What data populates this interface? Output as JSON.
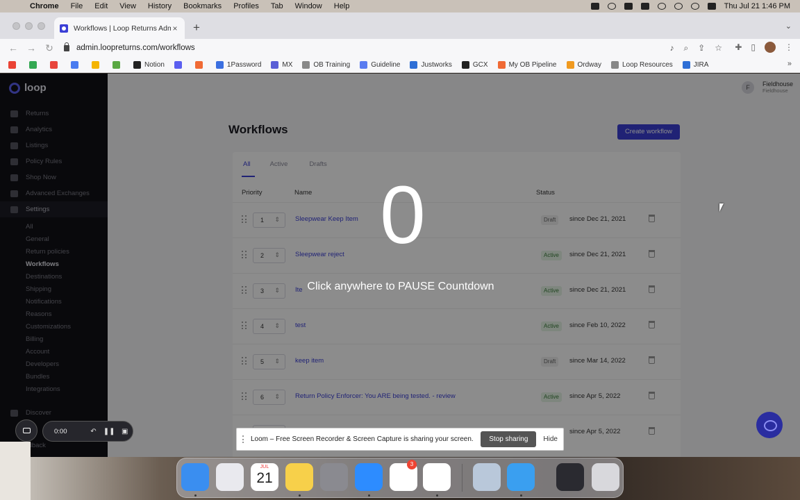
{
  "menubar": {
    "app": "Chrome",
    "items": [
      "File",
      "Edit",
      "View",
      "History",
      "Bookmarks",
      "Profiles",
      "Tab",
      "Window",
      "Help"
    ],
    "clock": "Thu Jul 21  1:46 PM"
  },
  "browser": {
    "tab_title": "Workflows | Loop Returns Adm",
    "url": "admin.loopreturns.com/workflows",
    "bookmarks": [
      {
        "label": "",
        "color": "#ea4335"
      },
      {
        "label": "",
        "color": "#34a853"
      },
      {
        "label": "",
        "color": "#e8453c"
      },
      {
        "label": "",
        "color": "#4a7cf0"
      },
      {
        "label": "",
        "color": "#f4b400"
      },
      {
        "label": "",
        "color": "#5aa843"
      },
      {
        "label": "Notion",
        "color": "#222222"
      },
      {
        "label": "",
        "color": "#5b5ff0"
      },
      {
        "label": "",
        "color": "#f06a35"
      },
      {
        "label": "1Password",
        "color": "#3b6fe0"
      },
      {
        "label": "MX",
        "color": "#5a5fd6"
      },
      {
        "label": "OB Training",
        "color": "#888888"
      },
      {
        "label": "Guideline",
        "color": "#5a7cf0"
      },
      {
        "label": "Justworks",
        "color": "#2f6fd6"
      },
      {
        "label": "GCX",
        "color": "#222222"
      },
      {
        "label": "My OB Pipeline",
        "color": "#f06a35"
      },
      {
        "label": "Ordway",
        "color": "#f09a20"
      },
      {
        "label": "Loop Resources",
        "color": "#888888"
      },
      {
        "label": "JIRA",
        "color": "#2f6fd6"
      }
    ]
  },
  "sidebar": {
    "brand": "loop",
    "items": [
      {
        "label": "Returns"
      },
      {
        "label": "Analytics"
      },
      {
        "label": "Listings"
      },
      {
        "label": "Policy Rules"
      },
      {
        "label": "Shop Now"
      },
      {
        "label": "Advanced Exchanges"
      },
      {
        "label": "Settings"
      }
    ],
    "sub_items": [
      "All",
      "General",
      "Return policies",
      "Workflows",
      "Destinations",
      "Shipping",
      "Notifications",
      "Reasons",
      "Customizations",
      "Billing",
      "Account",
      "Developers",
      "Bundles",
      "Integrations"
    ],
    "discover": "Discover",
    "feedback": "eedback"
  },
  "header": {
    "avatar_initial": "F",
    "user_name": "Fieldhouse",
    "user_sub": "Fieldhouse"
  },
  "main": {
    "title": "Workflows",
    "create_button": "Create workflow",
    "tabs": [
      "All",
      "Active",
      "Drafts"
    ],
    "columns": {
      "priority": "Priority",
      "name": "Name",
      "status": "Status"
    },
    "rows": [
      {
        "priority": "1",
        "name": "Sleepwear Keep Item",
        "status": "Draft",
        "since": "since Dec 21, 2021"
      },
      {
        "priority": "2",
        "name": "Sleepwear reject",
        "status": "Active",
        "since": "since Dec 21, 2021"
      },
      {
        "priority": "3",
        "name": "Ite",
        "status": "Active",
        "since": "since Dec 21, 2021"
      },
      {
        "priority": "4",
        "name": "test",
        "status": "Active",
        "since": "since Feb 10, 2022"
      },
      {
        "priority": "5",
        "name": "keep item",
        "status": "Draft",
        "since": "since Mar 14, 2022"
      },
      {
        "priority": "6",
        "name": "Return Policy Enforcer: You ARE being tested. - review",
        "status": "Active",
        "since": "since Apr 5, 2022"
      },
      {
        "priority": "",
        "name": "",
        "status": "",
        "since": "since Apr 5, 2022"
      }
    ]
  },
  "overlay": {
    "countdown": "0",
    "message": "Click anywhere to PAUSE Countdown"
  },
  "loom": {
    "timer": "0:00",
    "banner": "Loom – Free Screen Recorder & Screen Capture is sharing your screen.",
    "stop_label": "Stop sharing",
    "hide_label": "Hide"
  },
  "dock": {
    "calendar_month": "JUL",
    "calendar_day": "21",
    "slack_badge": "3",
    "apps": [
      {
        "icon": "finder-icon",
        "color": "#3a8ef0"
      },
      {
        "icon": "launchpad-icon",
        "color": "#e9e9ee"
      },
      {
        "icon": "calendar-icon",
        "color": "#ffffff"
      },
      {
        "icon": "notes-icon",
        "color": "#f7d04a"
      },
      {
        "icon": "system-preferences-icon",
        "color": "#8a8a90"
      },
      {
        "icon": "zoom-icon",
        "color": "#2d8cff"
      },
      {
        "icon": "slack-icon",
        "color": "#ffffff"
      },
      {
        "icon": "chrome-icon",
        "color": "#ffffff"
      },
      {
        "icon": "preview-icon",
        "color": "#b9c8da"
      },
      {
        "icon": "safari-icon",
        "color": "#3a9ff0"
      },
      {
        "icon": "window-icon",
        "color": "#2a2a30"
      },
      {
        "icon": "trash-icon",
        "color": "#d8d8dc"
      }
    ]
  }
}
